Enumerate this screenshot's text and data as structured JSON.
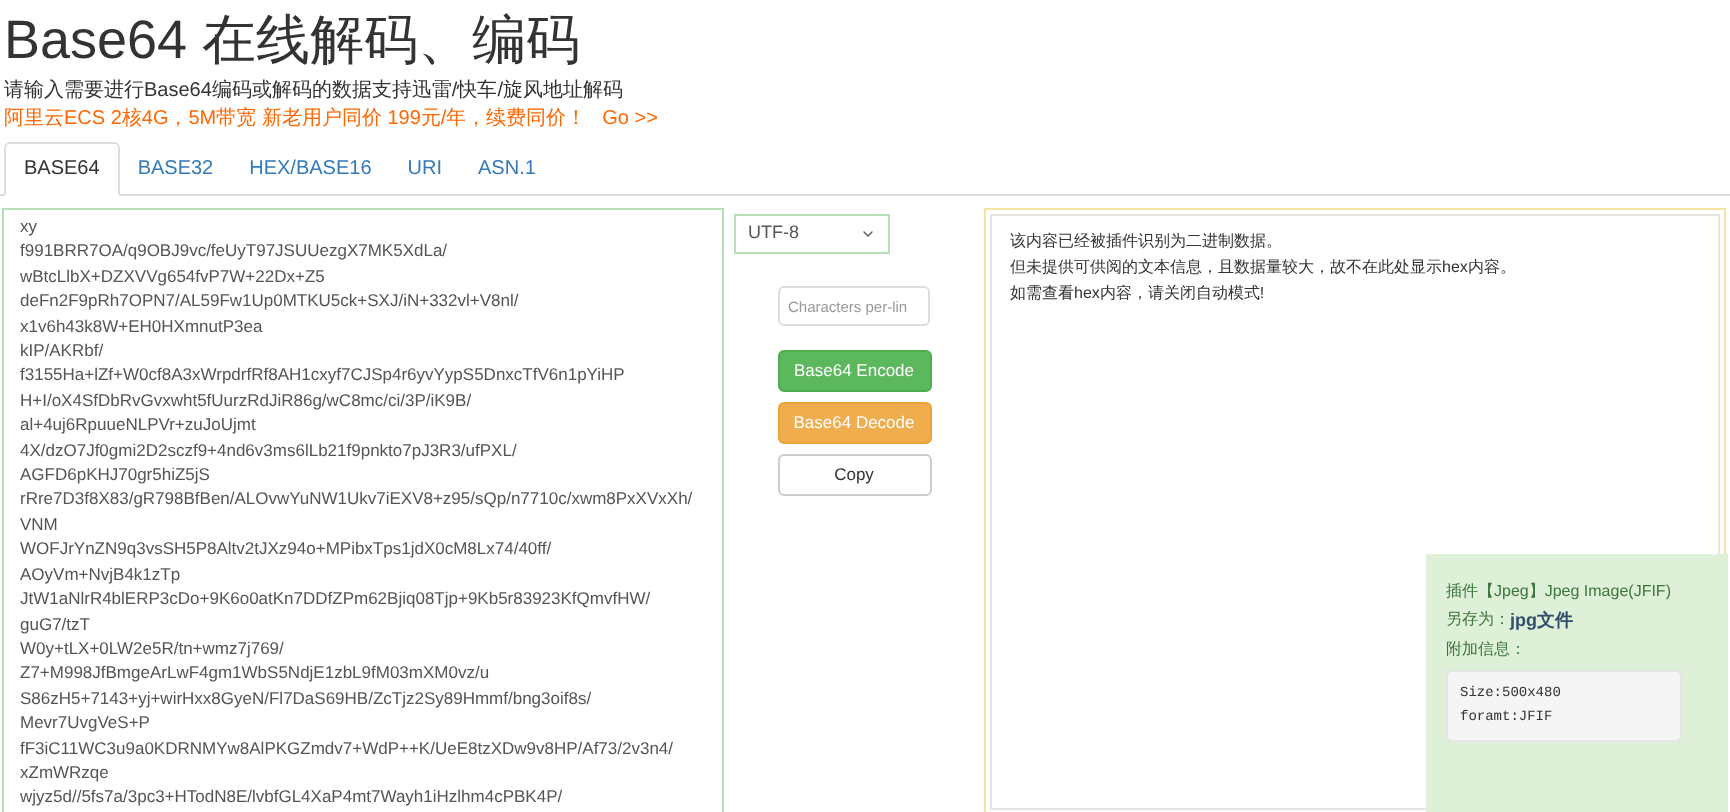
{
  "title": "Base64 在线解码、编码",
  "subtitle": "请输入需要进行Base64编码或解码的数据支持迅雷/快车/旋风地址解码",
  "promo": {
    "text": "阿里云ECS 2核4G，5M带宽 新老用户同价 199元/年，续费同价！",
    "link": "Go >>"
  },
  "tabs": [
    {
      "label": "BASE64",
      "selected": true
    },
    {
      "label": "BASE32",
      "selected": false
    },
    {
      "label": "HEX/BASE16",
      "selected": false
    },
    {
      "label": "URI",
      "selected": false
    },
    {
      "label": "ASN.1",
      "selected": false
    }
  ],
  "input_lines": [
    "xy",
    "f991BRR7OA/q9OBJ9vc/feUyT97JSUUezgX7MK5XdLa/",
    "wBtcLlbX+DZXVVg654fvP7W+22Dx+Z5",
    "deFn2F9pRh7OPN7/AL59Fw1Up0MTKU5ck+SXJ/iN+332vl+V8nl/",
    "x1v6h43k8W+EH0HXmnutP3ea",
    "kIP/AKRbf/",
    "f3155Ha+lZf+W0cf8A3xWrpdrfRf8AH1cxyf7CJSp4r6yvYypS5DnxcTfV6n1pYiHP",
    "H+I/oX4SfDbRvGvxwht5fUurzRdJiR86g/wC8mc/ci/3P/iK9B/",
    "al+4uj6RpuueNLPVr+zuJoUjmt",
    "4X/dzO7Jf0gmi2D2sczf9+4nd6v3ms6lLb21f9pnkto7pJ3R3/ufPXL/",
    "AGFD6pKHJ70gr5hiZ5jS",
    "rRre7D3f8X83/gR798BfBen/ALOvwYuNW1Ukv7iEXV8+z95/sQp/n7710c/xwm8PxXVxXh/",
    "VNM",
    "WOFJrYnZN9q3vsSH5P8Altv2tJXz94o+MPibxTps1jdX0cM8Lx74/40ff/",
    "AOyVm+NvjB4k1zTp",
    "JtW1aNlrR4blERP3cDo+9K6o0atKn7DDfZPm62Bjiq08Tjp+9Kb5r83923KfQmvfHW/",
    "guG7/tzT",
    "W0y+tLX+0LW2e5R/tn+wmz7j769/",
    "Z7+M998JfBmgeArLwF4gm1WbS5NdjE1zbL9fM03mXM0vz/u",
    "S86zH5+7143+yj+wirHxx8GyeN/Fl7DaS69HB/ZcTjz2Sy89Hmmf/bng3oif8s/",
    "Mevr7UvgVeS+P",
    "fF3iC11WC3u9a0KDRNMYw8AlPKGZmdv7+WdP++K/UeE8tzXDw9v8HP/Af73/2v3n4/",
    "xZmWRzqe",
    "wjyz5d//5fs7a/3pc3+HTodN8E/lvbfGL4XaP4mt7Wayh1iHzlhm4cPBK4P/"
  ],
  "encoding": "UTF-8",
  "chars_per_line": {
    "placeholder": "Characters per-lin"
  },
  "buttons": [
    {
      "kind": "encode",
      "label": "Base64 Encode"
    },
    {
      "kind": "decode",
      "label": "Base64 Decode"
    },
    {
      "kind": "copy",
      "label": "Copy"
    }
  ],
  "output_lines": [
    "该内容已经被插件识别为二进制数据。",
    "但未提供可供阅的文本信息，且数据量较大，故不在此处显示hex内容。",
    "如需查看hex内容，请关闭自动模式!"
  ],
  "plugin": {
    "title": "插件【Jpeg】Jpeg Image(JFIF)",
    "save_label": "另存为：",
    "save_value": "jpg文件",
    "extra_label": "附加信息：",
    "extra_lines": [
      "Size:500x480",
      "foramt:JFIF"
    ]
  }
}
